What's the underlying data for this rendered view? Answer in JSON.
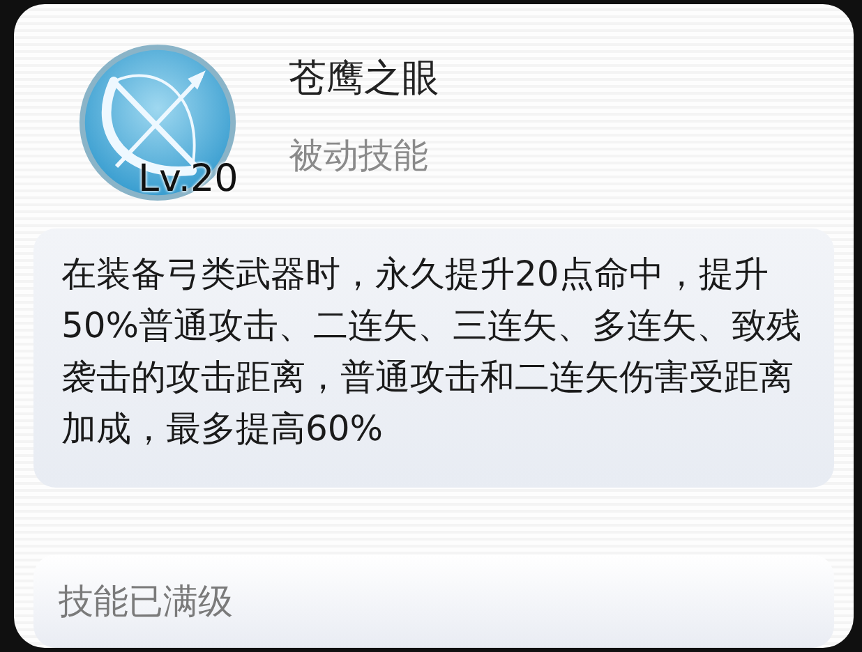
{
  "skill": {
    "level": "Lv.20",
    "name": "苍鹰之眼",
    "type": "被动技能"
  },
  "description": "在装备弓类武器时，永久提升20点命中，提升50%普通攻击、二连矢、三连矢、多连矢、致残袭击的攻击距离，普通攻击和二连矢伤害受距离加成，最多提高60%",
  "status": "技能已满级"
}
